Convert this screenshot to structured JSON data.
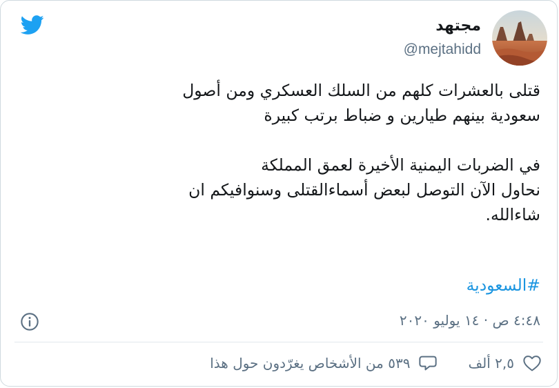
{
  "tweet": {
    "author": {
      "name": "مجتهد",
      "handle": "@mejtahidd"
    },
    "text_lines": [
      "قتلى بالعشرات كلهم من السلك العسكري ومن أصول",
      "سعودية بينهم طيارين و ضباط برتب كبيرة",
      "",
      "في الضربات اليمنية الأخيرة لعمق المملكة",
      "نحاول الآن التوصل لبعض أسماءالقتلى وسنوافيكم ان",
      "شاءالله."
    ],
    "hashtag": "#السعودية",
    "timestamp": "٤:٤٨ ص · ١٤ يوليو ٢٠٢٠",
    "likes": "٢,٥ ألف",
    "conversation": "٥٣٩ من الأشخاص يغرّدون حول هذا"
  },
  "colors": {
    "brand": "#1da1f2",
    "link": "#1b95e0",
    "secondary_text": "#5b7083",
    "border": "#cfd9de"
  },
  "icons": {
    "logo": "twitter-bird-icon",
    "info": "info-icon",
    "like": "heart-icon",
    "reply": "speech-bubble-icon"
  }
}
